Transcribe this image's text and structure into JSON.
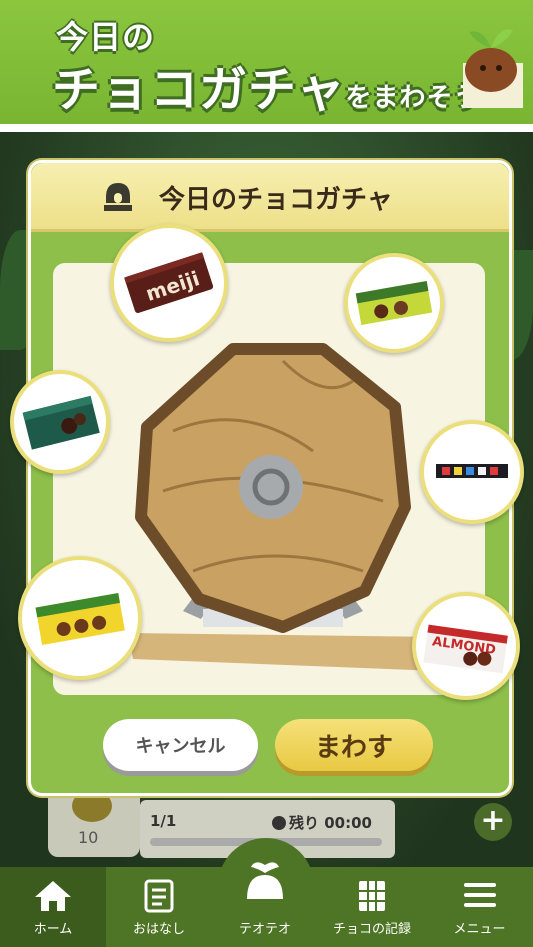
{
  "banner": {
    "line1": "今日の",
    "line2_big": "チョコガチャ",
    "line2_small": "をまわそう"
  },
  "modal": {
    "title": "今日のチョコガチャ",
    "cancel_label": "キャンセル",
    "spin_label": "まわす"
  },
  "progress": {
    "coin_count": "10",
    "count_text": "1/1",
    "remaining_text": "残り 00:00",
    "fraction": 0.0
  },
  "nav": {
    "items": [
      {
        "label": "ホーム",
        "icon": "home-icon",
        "active": true
      },
      {
        "label": "おはなし",
        "icon": "book-icon",
        "active": false
      },
      {
        "label": "テオテオ",
        "icon": "teote-icon",
        "active": false
      },
      {
        "label": "チョコの記録",
        "icon": "record-icon",
        "active": false
      },
      {
        "label": "メニュー",
        "icon": "menu-icon",
        "active": false
      }
    ]
  },
  "prizes": [
    {
      "name": "meiji milk chocolate",
      "icon": "chocolate-bar-icon",
      "logo_text": "meiji"
    },
    {
      "name": "green chocolate box",
      "icon": "chocolate-box-icon"
    },
    {
      "name": "dark green chocolate box",
      "icon": "chocolate-box-icon"
    },
    {
      "name": "chocolate stick",
      "icon": "chocolate-stick-icon"
    },
    {
      "name": "yellow chocolate box",
      "icon": "chocolate-box-icon"
    },
    {
      "name": "almond chocolate box",
      "icon": "chocolate-box-icon",
      "logo_text": "ALMOND"
    }
  ],
  "colors": {
    "banner_green": "#8cc63f",
    "modal_green": "#8dbf4a",
    "header_cream": "#f7efb0",
    "spin_gold": "#e8c942",
    "nav_green": "#4e7525"
  }
}
